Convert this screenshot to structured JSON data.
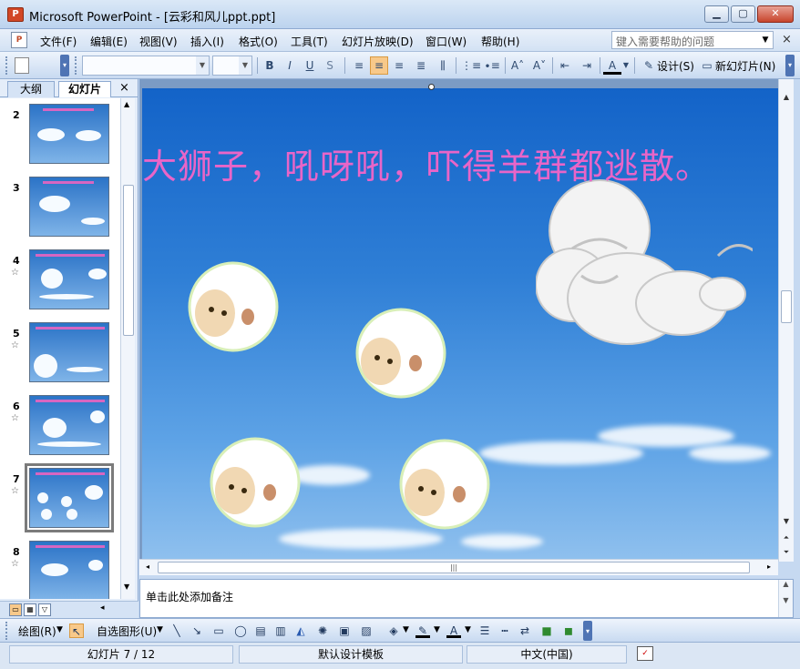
{
  "window": {
    "app_title": "Microsoft PowerPoint - [云彩和风儿ppt.ppt]",
    "app_icon": "powerpoint-icon",
    "min_label": "▁",
    "max_label": "▢",
    "close_label": "✕"
  },
  "menu": {
    "items": [
      "文件(F)",
      "编辑(E)",
      "视图(V)",
      "插入(I)",
      "格式(O)",
      "工具(T)",
      "幻灯片放映(D)",
      "窗口(W)",
      "帮助(H)"
    ],
    "help_placeholder": "键入需要帮助的问题",
    "close_glyph": "×"
  },
  "toolbar": {
    "font_name": "",
    "font_size": "",
    "bold": "B",
    "italic": "I",
    "underline": "U",
    "shadow": "S",
    "design_label": "设计(S)",
    "new_slide_label": "新幻灯片(N)"
  },
  "left_pane": {
    "tab_outline": "大纲",
    "tab_slides": "幻灯片",
    "close_glyph": "×",
    "slides": [
      {
        "num": "2",
        "star": ""
      },
      {
        "num": "3",
        "star": ""
      },
      {
        "num": "4",
        "star": "☆"
      },
      {
        "num": "5",
        "star": "☆"
      },
      {
        "num": "6",
        "star": "☆"
      },
      {
        "num": "7",
        "star": "☆"
      },
      {
        "num": "8",
        "star": "☆"
      }
    ],
    "selected_slide": "7"
  },
  "slide": {
    "title": "大狮子，吼呀吼，吓得羊群都逃散。",
    "title_color": "#e965c8",
    "background": "#1f6fcf"
  },
  "notes": {
    "placeholder": "单击此处添加备注"
  },
  "drawbar": {
    "draw_label": "绘图(R)",
    "autoshapes_label": "自选图形(U)"
  },
  "status": {
    "slide_counter": "幻灯片 7 / 12",
    "template": "默认设计模板",
    "language": "中文(中国)"
  }
}
